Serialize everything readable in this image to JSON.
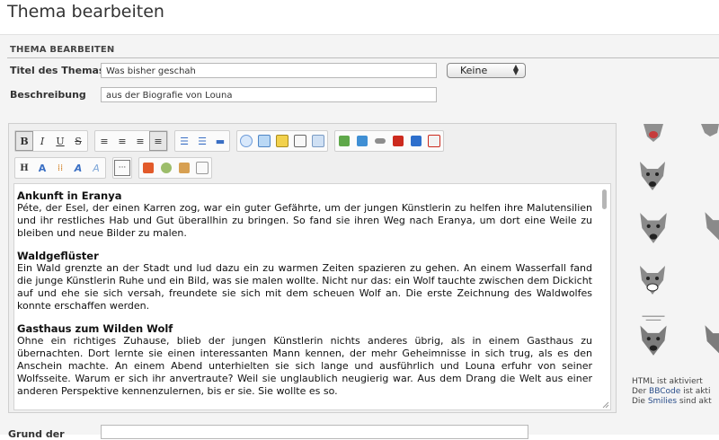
{
  "page": {
    "title": "Thema bearbeiten"
  },
  "form": {
    "section_heading": "THEMA BEARBEITEN",
    "title_label": "Titel des Themas",
    "title_value": "Was bisher geschah",
    "prefix_select": "Keine",
    "description_label": "Beschreibung",
    "description_value": "aus der Biografie von Louna"
  },
  "toolbar": {
    "row1": [
      "B",
      "I",
      "U",
      "S",
      "align-left",
      "align-center",
      "align-right",
      "justify",
      "bullet-list",
      "numbered-list",
      "horizontal-rule",
      "speech-bubble",
      "spoiler",
      "image",
      "edit",
      "code",
      "quote",
      "graphic",
      "link",
      "youtube",
      "info",
      "flash"
    ],
    "row2": [
      "H",
      "font-size",
      "color",
      "A",
      "A",
      "more",
      "table",
      "search",
      "paste",
      "document"
    ]
  },
  "editor": {
    "sections": [
      {
        "heading": "Ankunft in Eranya",
        "text": "Péte, der Esel, der einen Karren zog, war ein guter Gefährte, um der jungen Künstlerin zu helfen ihre Malutensilien und ihr restliches Hab und Gut überallhin zu bringen. So fand sie ihren Weg nach Eranya, um dort eine Weile zu bleiben und neue Bilder zu malen."
      },
      {
        "heading": "Waldgeflüster",
        "text": "Ein Wald grenzte an der Stadt und lud dazu ein zu warmen Zeiten spazieren zu gehen. An einem Wasserfall fand die junge Künstlerin Ruhe und ein Bild, was sie malen wollte. Nicht nur das: ein Wolf tauchte zwischen dem Dickicht auf und ehe sie sich versah, freundete sie sich mit dem scheuen Wolf an. Die erste Zeichnung des Waldwolfes konnte erschaffen werden."
      },
      {
        "heading": "Gasthaus zum Wilden Wolf",
        "text": "Ohne ein richtiges Zuhause, blieb der jungen Künstlerin nichts anderes übrig, als in einem Gasthaus zu übernachten. Dort lernte sie einen interessanten Mann kennen, der mehr Geheimnisse in sich trug, als es den Anschein machte. An einem Abend unterhielten sie sich lange und ausführlich und Louna erfuhr von seiner Wolfsseite. Warum er sich ihr anvertraute? Weil sie unglaublich neugierig war. Aus dem Drang die Welt aus einer anderen Perspektive kennenzulernen, bis er sie. Sie wollte es so."
      }
    ]
  },
  "status": {
    "html": "HTML ist aktiviert",
    "bbcode_prefix": "Der ",
    "bbcode_link": "BBCode",
    "bbcode_suffix": " ist akti",
    "smilies_prefix": "Die ",
    "smilies_link": "Smilies",
    "smilies_suffix": " sind akt"
  },
  "bottom": {
    "label": "Grund der"
  }
}
